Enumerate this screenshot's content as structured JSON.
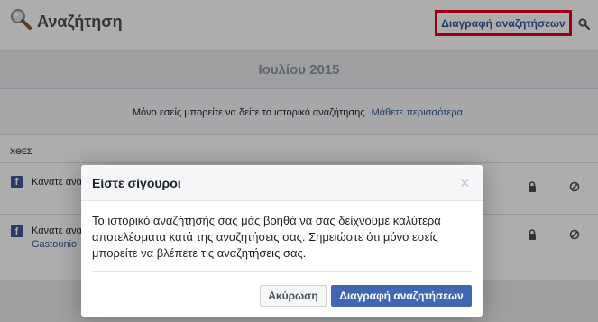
{
  "header": {
    "title": "Αναζήτηση",
    "clear_label": "Διαγραφή αναζητήσεων"
  },
  "month": "Ιουλίου 2015",
  "notice": {
    "text": "Μόνο εσείς μπορείτε να δείτε το ιστορικό αναζήτησης.",
    "link": "Μάθετε περισσότερα."
  },
  "day_label": "ΧΘΕΣ",
  "rows": [
    {
      "text": "Κάνατε αναζ",
      "sub": ""
    },
    {
      "text": "Κάνατε αναζ",
      "sub": "Gastounio"
    }
  ],
  "dialog": {
    "title": "Είστε σίγουροι",
    "close": "×",
    "body": "Το ιστορικό αναζήτησής σας μάς βοηθά να σας δείχνουμε καλύτερα αποτελέσματα κατά της αναζητήσεις σας. Σημειώστε ότι μόνο εσείς μπορείτε να βλέπετε τις αναζητήσεις σας.",
    "cancel_label": "Ακύρωση",
    "confirm_label": "Διαγραφή αναζητήσεων"
  },
  "colors": {
    "link": "#365899",
    "primary_button": "#4267b2",
    "highlight_border": "#e3001b"
  }
}
